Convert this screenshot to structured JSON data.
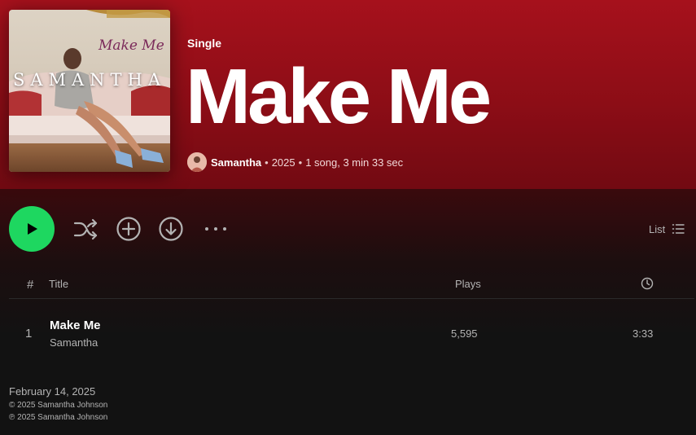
{
  "album": {
    "type_label": "Single",
    "title": "Make Me",
    "artist": "Samantha",
    "year": "2025",
    "summary": "1 song, 3 min 33 sec",
    "cover_artist_text": "SAMANTHA",
    "cover_title_text": "Make Me"
  },
  "actions": {
    "play": "play-icon",
    "shuffle": "shuffle-icon",
    "add": "add-circle-icon",
    "download": "download-icon",
    "more": "more-options-icon",
    "view_label": "List"
  },
  "table": {
    "headers": {
      "num": "#",
      "title": "Title",
      "plays": "Plays",
      "duration_icon": "clock-icon"
    },
    "rows": [
      {
        "num": "1",
        "title": "Make Me",
        "artist": "Samantha",
        "plays": "5,595",
        "duration": "3:33"
      }
    ]
  },
  "footer": {
    "release_date": "February 14, 2025",
    "copyright_c": "© 2025 Samantha Johnson",
    "copyright_p": "℗ 2025 Samantha Johnson"
  },
  "colors": {
    "hero_gradient_top": "#a6111c",
    "accent_green": "#1ed760",
    "background": "#121212",
    "muted_text": "#b3b3b3"
  }
}
